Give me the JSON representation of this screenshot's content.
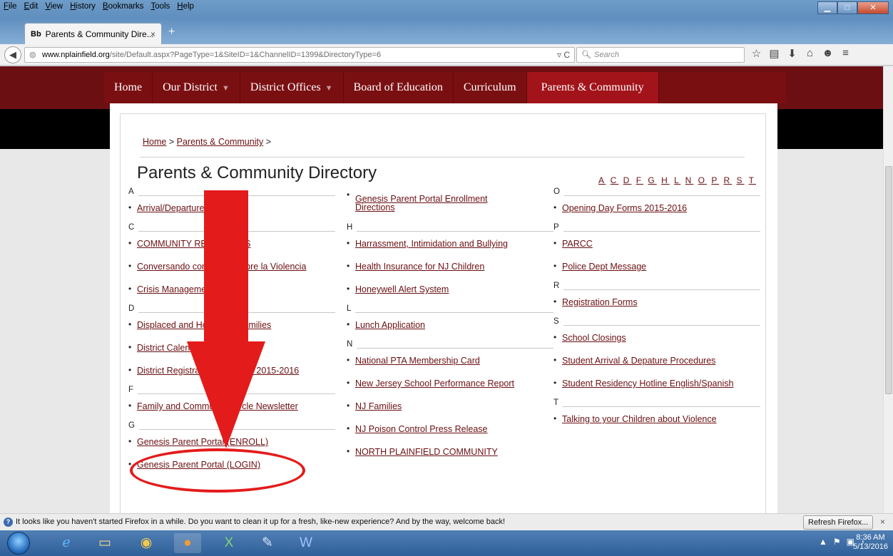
{
  "menubar": [
    "File",
    "Edit",
    "View",
    "History",
    "Bookmarks",
    "Tools",
    "Help"
  ],
  "tab": {
    "favicon": "Bb",
    "title": "Parents & Community Dire...",
    "close": "×"
  },
  "newtab": "+",
  "url": {
    "domain": "www.nplainfield.org",
    "path": "/site/Default.aspx?PageType=1&SiteID=1&ChannelID=1399&DirectoryType=6"
  },
  "search": {
    "placeholder": "Search"
  },
  "sitenav": [
    {
      "label": "Home",
      "dropdown": false,
      "active": false
    },
    {
      "label": "Our District",
      "dropdown": true,
      "active": false
    },
    {
      "label": "District Offices",
      "dropdown": true,
      "active": false
    },
    {
      "label": "Board of Education",
      "dropdown": false,
      "active": false
    },
    {
      "label": "Curriculum",
      "dropdown": false,
      "active": false
    },
    {
      "label": "Parents & Community",
      "dropdown": false,
      "active": true
    }
  ],
  "breadcrumb": {
    "home": "Home",
    "sep": ">",
    "current": "Parents & Community"
  },
  "page_title": "Parents & Community Directory",
  "alphabet": [
    "A",
    "C",
    "D",
    "F",
    "G",
    "H",
    "L",
    "N",
    "O",
    "P",
    "R",
    "S",
    "T"
  ],
  "columns": [
    [
      {
        "letter": "A",
        "items": [
          "Arrival/Departure Times"
        ]
      },
      {
        "letter": "C",
        "items": [
          "COMMUNITY RESOURCES",
          "Conversando con Niños Sobre la Violencia",
          "Crisis Management"
        ]
      },
      {
        "letter": "D",
        "items": [
          "Displaced and Homeless Families",
          "District Calendar",
          "District Registration Schedule 2015-2016"
        ]
      },
      {
        "letter": "F",
        "items": [
          "Family and Community Circle Newsletter"
        ]
      },
      {
        "letter": "G",
        "items": [
          "Genesis Parent Portal (ENROLL)",
          "Genesis Parent Portal (LOGIN)"
        ]
      }
    ],
    [
      {
        "letter": "",
        "items": [
          "Genesis Parent Portal Enrollment Directions"
        ]
      },
      {
        "letter": "H",
        "items": [
          "Harrassment, Intimidation and Bullying",
          "Health Insurance for NJ Children",
          "Honeywell Alert System"
        ]
      },
      {
        "letter": "L",
        "items": [
          "Lunch Application"
        ]
      },
      {
        "letter": "N",
        "items": [
          "National PTA Membership Card",
          "New Jersey School Performance Report",
          "NJ Families",
          "NJ Poison Control Press Release",
          "NORTH PLAINFIELD COMMUNITY"
        ]
      }
    ],
    [
      {
        "letter": "O",
        "items": [
          "Opening Day Forms 2015-2016"
        ]
      },
      {
        "letter": "P",
        "items": [
          "PARCC",
          "Police Dept Message"
        ]
      },
      {
        "letter": "R",
        "items": [
          "Registration Forms"
        ]
      },
      {
        "letter": "S",
        "items": [
          "School Closings",
          "Student Arrival & Depature Procedures",
          "Student Residency Hotline English/Spanish"
        ]
      },
      {
        "letter": "T",
        "items": [
          "Talking to your Children about Violence"
        ]
      }
    ]
  ],
  "notification": {
    "text": "It looks like you haven't started Firefox in a while. Do you want to clean it up for a fresh, like-new experience? And by the way, welcome back!",
    "button": "Refresh Firefox...",
    "close": "×"
  },
  "clock": {
    "time": "8:36 AM",
    "date": "5/13/2016"
  },
  "colors": {
    "brand": "#6b0f12",
    "nav": "#7a0f12",
    "nav_active": "#a2131a",
    "annotation": "#e41b1b"
  }
}
